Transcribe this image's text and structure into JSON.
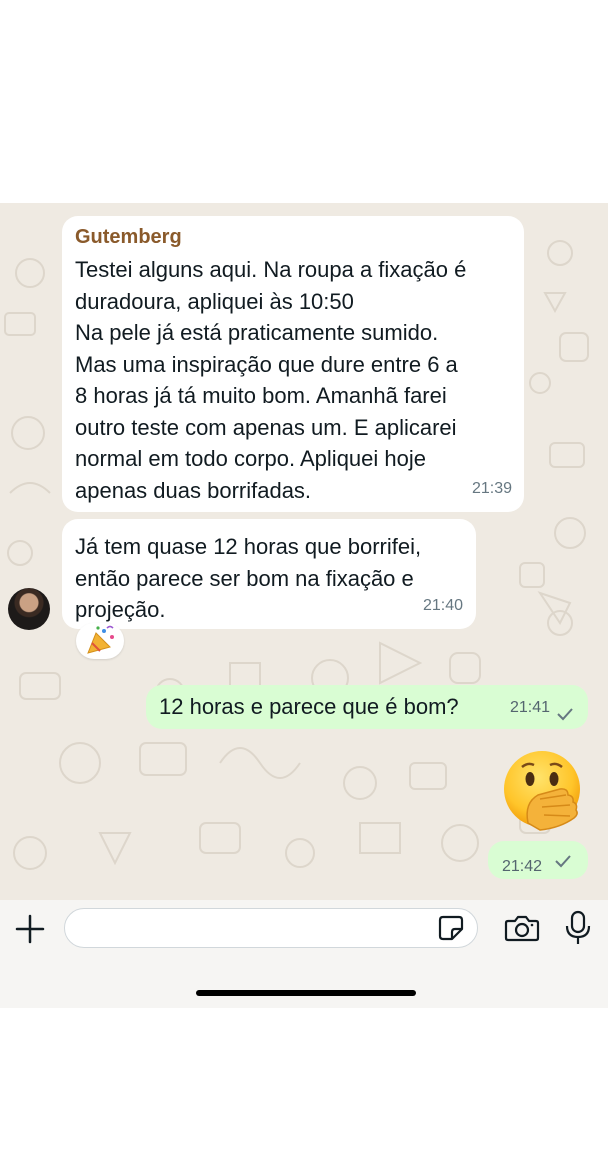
{
  "messages": [
    {
      "sender": "Gutemberg",
      "text": "Testei alguns aqui. Na roupa a fixação é\nduradoura, apliquei às 10:50\nNa pele já está praticamente sumido.\nMas uma inspiração que dure entre 6 a\n8 horas já tá muito bom. Amanhã farei\noutro teste com apenas um. E aplicarei\nnormal em todo corpo. Apliquei hoje\napenas duas borrifadas.",
      "time": "21:39"
    },
    {
      "text": "Já tem quase 12 horas que borrifei,\nentão parece ser bom na fixação e\nprojeção.",
      "time": "21:40",
      "reaction": "party-popper"
    },
    {
      "text": "12 horas e parece que é bom?",
      "time": "21:41",
      "status": "sent"
    },
    {
      "emoji": "face-with-hand-over-mouth",
      "time": "21:42",
      "status": "sent"
    }
  ],
  "composer": {
    "placeholder": ""
  },
  "colors": {
    "chat_background": "#efeae2",
    "incoming_bubble": "#ffffff",
    "outgoing_bubble": "#d9fdd3",
    "sender_name": "#8a5a2b"
  }
}
